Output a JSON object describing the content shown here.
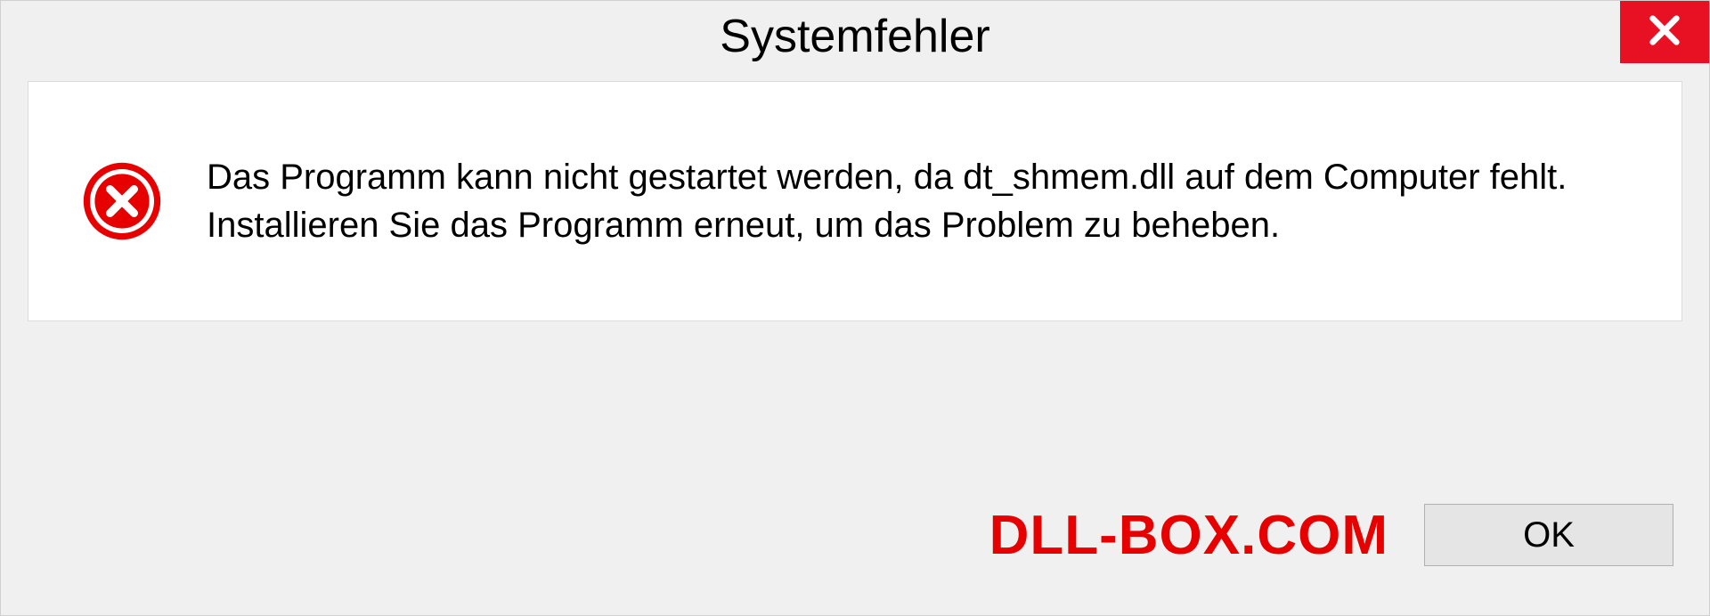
{
  "dialog": {
    "title": "Systemfehler",
    "message": "Das Programm kann nicht gestartet werden, da dt_shmem.dll auf dem Computer fehlt. Installieren Sie das Programm erneut, um das Problem zu beheben.",
    "ok_label": "OK"
  },
  "watermark": "DLL-BOX.COM",
  "colors": {
    "close_bg": "#e81123",
    "error_icon": "#e60000",
    "watermark": "#e60000"
  }
}
